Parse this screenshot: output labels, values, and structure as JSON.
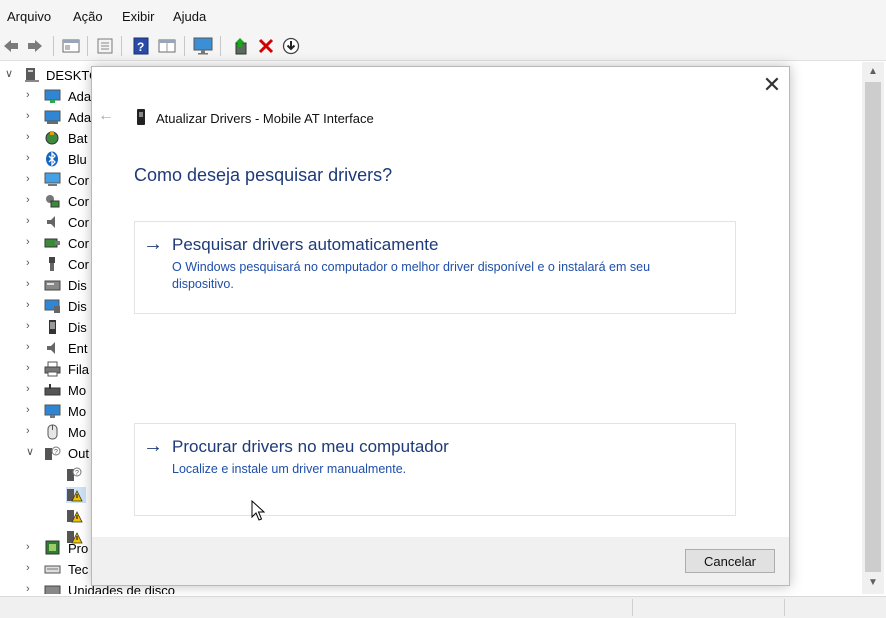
{
  "menubar": {
    "items": [
      "Arquivo",
      "Ação",
      "Exibir",
      "Ajuda"
    ]
  },
  "toolbar": {
    "buttons": [
      "back-icon",
      "forward-icon",
      "properties-view-icon",
      "list-view-icon",
      "help-icon",
      "details-view-icon",
      "monitor-icon",
      "update-driver-icon",
      "uninstall-icon",
      "download-icon"
    ]
  },
  "tree": {
    "root": "DESKTO",
    "items": [
      {
        "label": "Ada",
        "icon": "display-adapter-icon"
      },
      {
        "label": "Ada",
        "icon": "network-adapter-icon"
      },
      {
        "label": "Bat",
        "icon": "battery-icon"
      },
      {
        "label": "Blu",
        "icon": "bluetooth-icon"
      },
      {
        "label": "Cor",
        "icon": "computer-icon"
      },
      {
        "label": "Cor",
        "icon": "controller-icon"
      },
      {
        "label": "Cor",
        "icon": "audio-icon"
      },
      {
        "label": "Cor",
        "icon": "storage-controller-icon"
      },
      {
        "label": "Cor",
        "icon": "usb-icon"
      },
      {
        "label": "Dis",
        "icon": "disk-icon"
      },
      {
        "label": "Dis",
        "icon": "display-device-icon"
      },
      {
        "label": "Dis",
        "icon": "portable-device-icon"
      },
      {
        "label": "Ent",
        "icon": "audio-input-icon"
      },
      {
        "label": "Fila",
        "icon": "print-queue-icon"
      },
      {
        "label": "Mo",
        "icon": "modem-icon"
      },
      {
        "label": "Mo",
        "icon": "monitor-icon"
      },
      {
        "label": "Mo",
        "icon": "mouse-icon"
      },
      {
        "label": "Out",
        "icon": "other-devices-icon"
      },
      {
        "label": "Pro",
        "icon": "processor-icon"
      },
      {
        "label": "Tec",
        "icon": "keyboard-icon"
      },
      {
        "label": "Unidades de disco",
        "icon": "disk-drive-icon"
      }
    ],
    "sub_items": [
      "unknown-device-icon",
      "warning-device-icon",
      "warning-device-icon",
      "warning-device-icon"
    ]
  },
  "dialog": {
    "title": "Atualizar Drivers - Mobile AT Interface",
    "heading": "Como deseja pesquisar drivers?",
    "option1": {
      "title": "Pesquisar drivers automaticamente",
      "description": "O Windows pesquisará no computador o melhor driver disponível e o instalará em seu dispositivo."
    },
    "option2": {
      "title": "Procurar drivers no meu computador",
      "description": "Localize e instale um driver manualmente."
    },
    "cancel": "Cancelar"
  },
  "colors": {
    "accent": "#1e3a78",
    "link": "#1f4ea8",
    "uninstall": "#d40000"
  }
}
